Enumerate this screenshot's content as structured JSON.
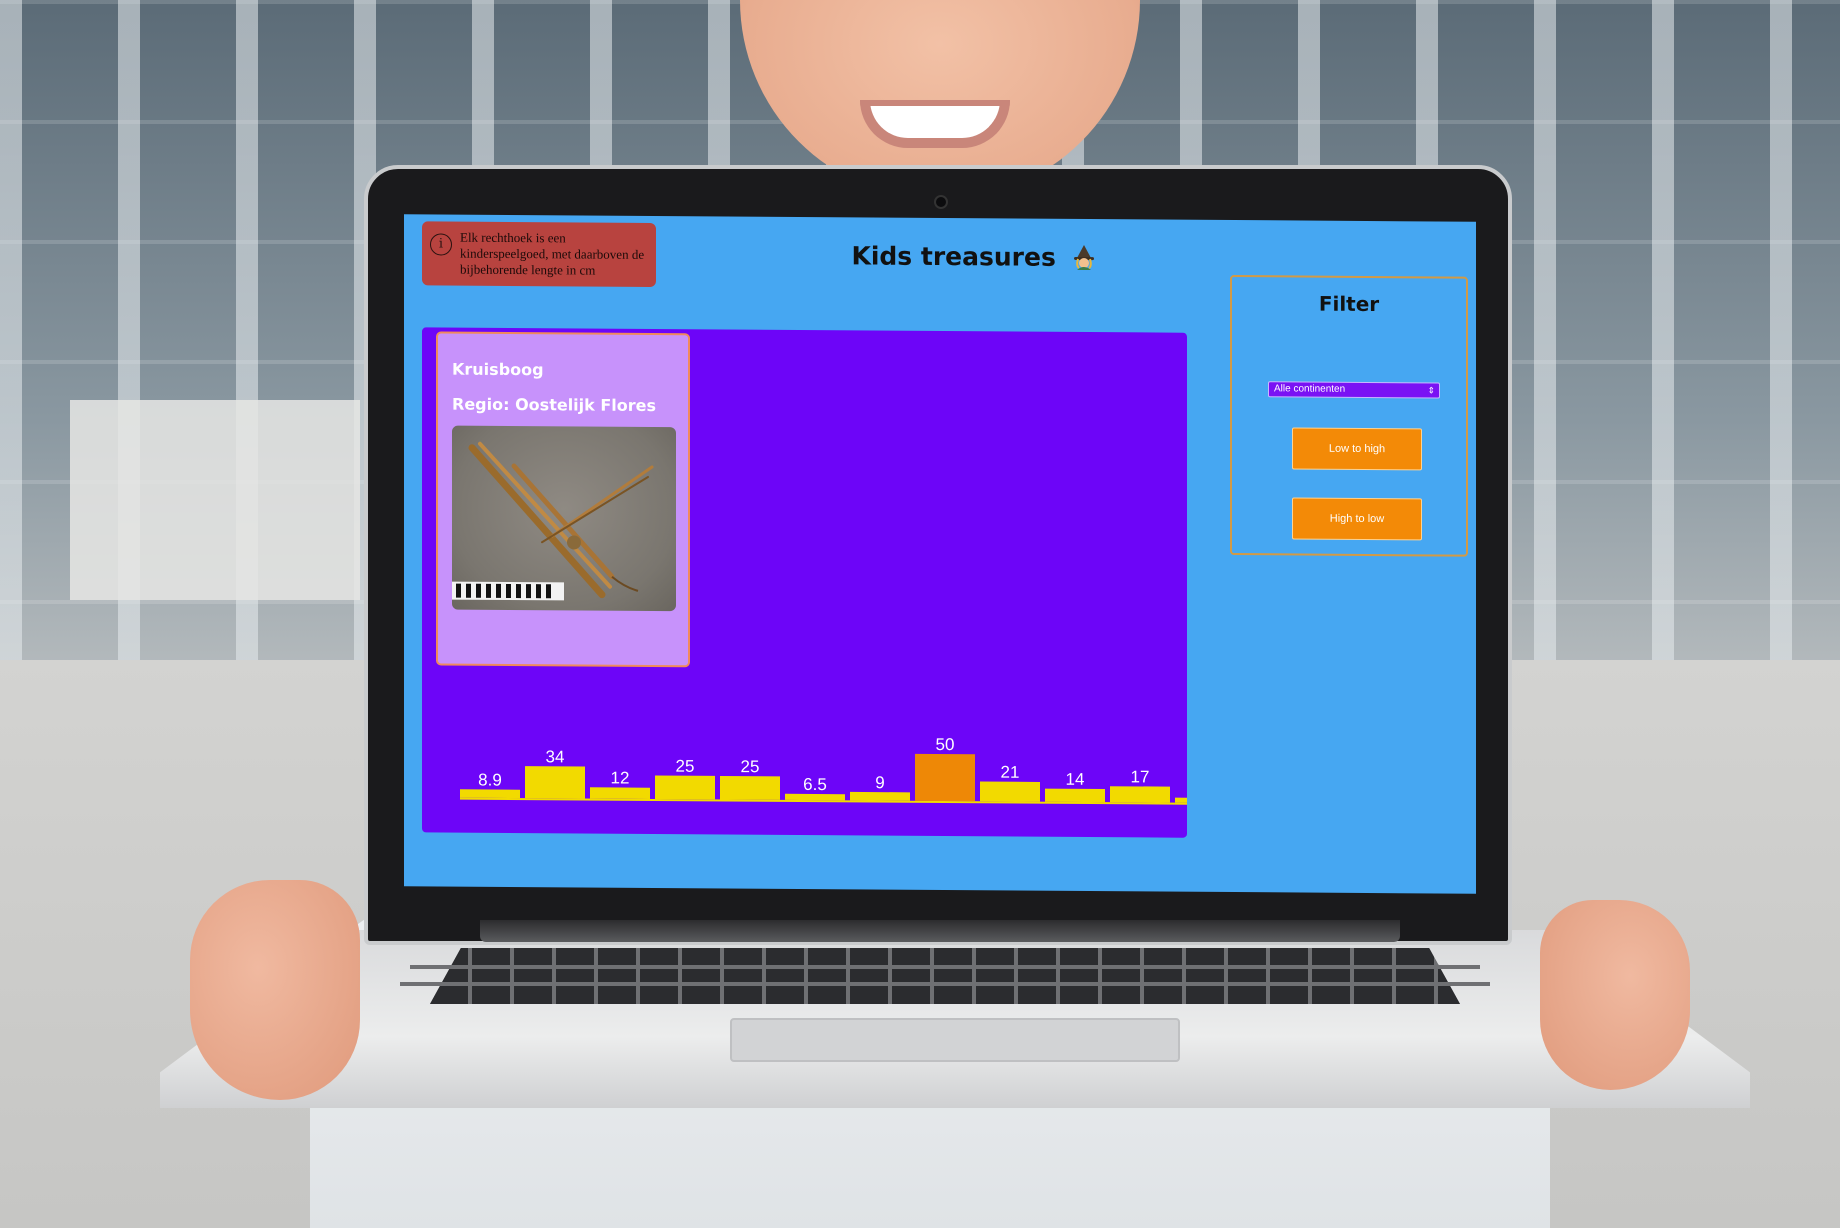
{
  "app": {
    "title": "Kids treasures",
    "title_emoji": "witch-emoji",
    "background_color": "#46a7f2"
  },
  "info": {
    "icon": "info-icon",
    "icon_glyph": "i",
    "text": "Elk rechthoek is een kinderspeelgoed, met daarboven de bijbehorende lengte in cm",
    "background_color": "#b8433f"
  },
  "card": {
    "title": "Kruisboog",
    "region": "Regio: Oostelijk Flores",
    "image_subject": "crossbow-photo",
    "background_color": "#c792fb",
    "border_color": "#f08a5b"
  },
  "filter": {
    "title": "Filter",
    "select_value": "Alle continenten",
    "low_to_high": "Low to high",
    "high_to_low": "High to low",
    "button_color": "#f38a07"
  },
  "chart_data": {
    "type": "bar",
    "title": "",
    "xlabel": "",
    "ylabel": "",
    "values": [
      8.9,
      34,
      12,
      25,
      25,
      6.5,
      9,
      50,
      21,
      14,
      17
    ],
    "labels": [
      "8.9",
      "34",
      "12",
      "25",
      "25",
      "6.5",
      "9",
      "50",
      "21",
      "14",
      "17"
    ],
    "highlighted_index": 7,
    "bar_color": "#f2da00",
    "highlight_color": "#ee8806",
    "background_color": "#6d05f8",
    "ylim": [
      0,
      50
    ],
    "truncated_extra_bar": true
  }
}
